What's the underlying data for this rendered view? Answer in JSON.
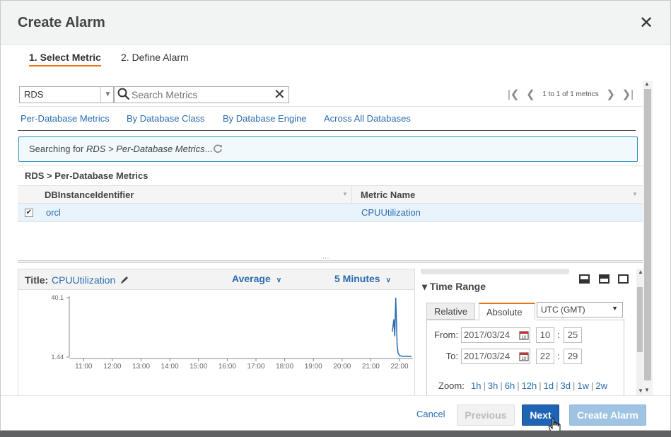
{
  "dialog": {
    "title": "Create Alarm"
  },
  "steps": {
    "step1": "1. Select Metric",
    "step2": "2. Define Alarm"
  },
  "toolbar": {
    "namespace": "RDS",
    "search_placeholder": "Search Metrics",
    "pager_text": "1 to 1 of 1 metrics"
  },
  "metric_tabs": [
    "Per-Database Metrics",
    "By Database Class",
    "By Database Engine",
    "Across All Databases"
  ],
  "info": {
    "prefix": "Searching for ",
    "path": "RDS > Per-Database Metrics",
    "suffix": "..."
  },
  "breadcrumb": "RDS > Per-Database Metrics",
  "table": {
    "columns": [
      "DBInstanceIdentifier",
      "Metric Name"
    ],
    "rows": [
      {
        "checked": true,
        "instance": "orcl",
        "metric": "CPUUtilization"
      }
    ]
  },
  "chart_panel": {
    "title_label": "Title:",
    "title_value": "CPUUtilization",
    "statistic": "Average",
    "period": "5 Minutes"
  },
  "chart_data": {
    "type": "line",
    "y_ticks": [
      "40.1",
      "1.44"
    ],
    "ylim": [
      1.44,
      40.1
    ],
    "x_ticks": [
      "11:00",
      "12:00",
      "13:00",
      "14:00",
      "15:00",
      "16:00",
      "17:00",
      "18:00",
      "19:00",
      "20:00",
      "21:00",
      "22:00"
    ],
    "series": [
      {
        "x": [
          "21:45",
          "21:48",
          "21:50",
          "21:52",
          "21:55",
          "21:57",
          "22:00",
          "22:03",
          "22:05",
          "22:10",
          "22:15",
          "22:20",
          "22:25"
        ],
        "values": [
          18,
          26,
          15,
          40.1,
          9,
          4,
          2.5,
          2.2,
          2,
          1.9,
          2,
          1.9,
          1.8
        ]
      }
    ],
    "line_color": "#2a6cb0"
  },
  "time_range": {
    "title": "Time Range",
    "tabs": [
      "Relative",
      "Absolute"
    ],
    "active_tab": "Absolute",
    "timezone": "UTC (GMT)",
    "from_label": "From:",
    "from_date": "2017/03/24",
    "from_hour": "10",
    "from_min": "25",
    "to_label": "To:",
    "to_date": "2017/03/24",
    "to_hour": "22",
    "to_min": "29",
    "zoom_label": "Zoom:",
    "zoom_options": [
      "1h",
      "3h",
      "6h",
      "12h",
      "1d",
      "3d",
      "1w",
      "2w"
    ]
  },
  "footer": {
    "cancel": "Cancel",
    "previous": "Previous",
    "next": "Next",
    "create": "Create Alarm"
  }
}
